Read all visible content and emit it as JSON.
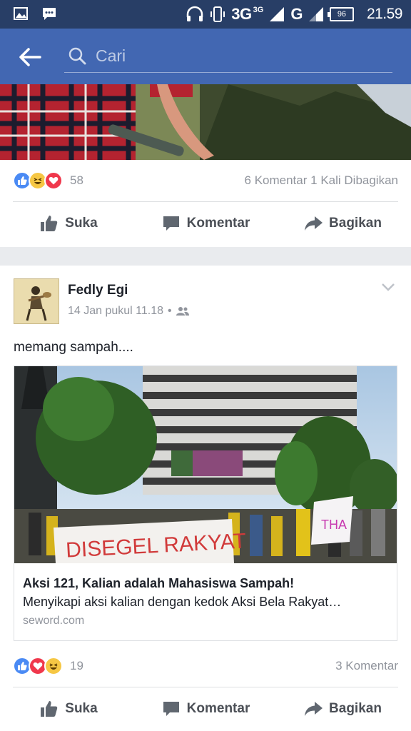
{
  "status_bar": {
    "network": "3G",
    "network_small": "3G",
    "network2": "G",
    "battery": "96",
    "time": "21.59"
  },
  "app_bar": {
    "search_placeholder": "Cari"
  },
  "post_top": {
    "reaction_count": "58",
    "comments": "6 Komentar",
    "shares": "1 Kali Dibagikan",
    "actions": {
      "like": "Suka",
      "comment": "Komentar",
      "share": "Bagikan"
    }
  },
  "post": {
    "author": "Fedly Egi",
    "timestamp": "14 Jan pukul 11.18",
    "separator": "•",
    "text": "memang sampah....",
    "link": {
      "banner_text": "DISEGEL RAKYAT",
      "title": "Aksi 121, Kalian adalah Mahasiswa Sampah!",
      "description": "Menyikapi aksi kalian dengan kedok Aksi Bela Rakyat…",
      "domain": "seword.com"
    },
    "reaction_count": "19",
    "comments": "3 Komentar",
    "actions": {
      "like": "Suka",
      "comment": "Komentar",
      "share": "Bagikan"
    }
  },
  "colors": {
    "status_bar": "#283e66",
    "app_bar": "#4267b2",
    "like": "#4a8af4",
    "love": "#f0384c",
    "haha": "#f6c744"
  }
}
